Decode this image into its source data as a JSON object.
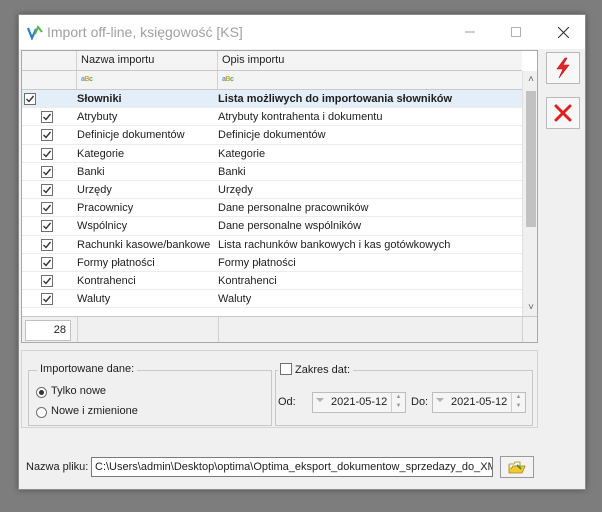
{
  "window": {
    "title": "Import off-line, księgowość [KS]"
  },
  "grid": {
    "columns": [
      "Nazwa importu",
      "Opis importu"
    ],
    "filter_icon": "abc-filter-icon",
    "rows": [
      {
        "name": "Słowniki",
        "desc": "Lista możliwych do importowania słowników",
        "checked": true,
        "level": 0,
        "selected": true
      },
      {
        "name": "Atrybuty",
        "desc": "Atrybuty kontrahenta i dokumentu",
        "checked": true,
        "level": 1
      },
      {
        "name": "Definicje dokumentów",
        "desc": "Definicje dokumentów",
        "checked": true,
        "level": 1
      },
      {
        "name": "Kategorie",
        "desc": "Kategorie",
        "checked": true,
        "level": 1
      },
      {
        "name": "Banki",
        "desc": "Banki",
        "checked": true,
        "level": 1
      },
      {
        "name": "Urzędy",
        "desc": "Urzędy",
        "checked": true,
        "level": 1
      },
      {
        "name": "Pracownicy",
        "desc": "Dane personalne pracowników",
        "checked": true,
        "level": 1
      },
      {
        "name": "Wspólnicy",
        "desc": "Dane personalne wspólników",
        "checked": true,
        "level": 1
      },
      {
        "name": "Rachunki kasowe/bankowe",
        "desc": "Lista rachunków bankowych i kas gotówkowych",
        "checked": true,
        "level": 1
      },
      {
        "name": "Formy płatności",
        "desc": "Formy płatności",
        "checked": true,
        "level": 1
      },
      {
        "name": "Kontrahenci",
        "desc": "Kontrahenci",
        "checked": true,
        "level": 1
      },
      {
        "name": "Waluty",
        "desc": "Waluty",
        "checked": true,
        "level": 1
      }
    ],
    "count": "28"
  },
  "side_buttons": {
    "run_icon": "lightning-icon",
    "cancel_icon": "red-x-icon"
  },
  "import_options": {
    "group_label": "Importowane dane:",
    "options": [
      "Tylko nowe",
      "Nowe i zmienione"
    ],
    "selected": "Tylko nowe"
  },
  "date_range": {
    "checkbox_label": "Zakres dat:",
    "checked": false,
    "from_label": "Od:",
    "from_value": "2021-05-12",
    "to_label": "Do:",
    "to_value": "2021-05-12"
  },
  "file": {
    "label": "Nazwa pliku:",
    "path": "C:\\Users\\admin\\Desktop\\optima\\Optima_eksport_dokumentow_sprzedazy_do_XML_",
    "browse_icon": "folder-browse-icon"
  },
  "colors": {
    "run_accent": "#e8262a",
    "selection": "#e4eef8"
  }
}
